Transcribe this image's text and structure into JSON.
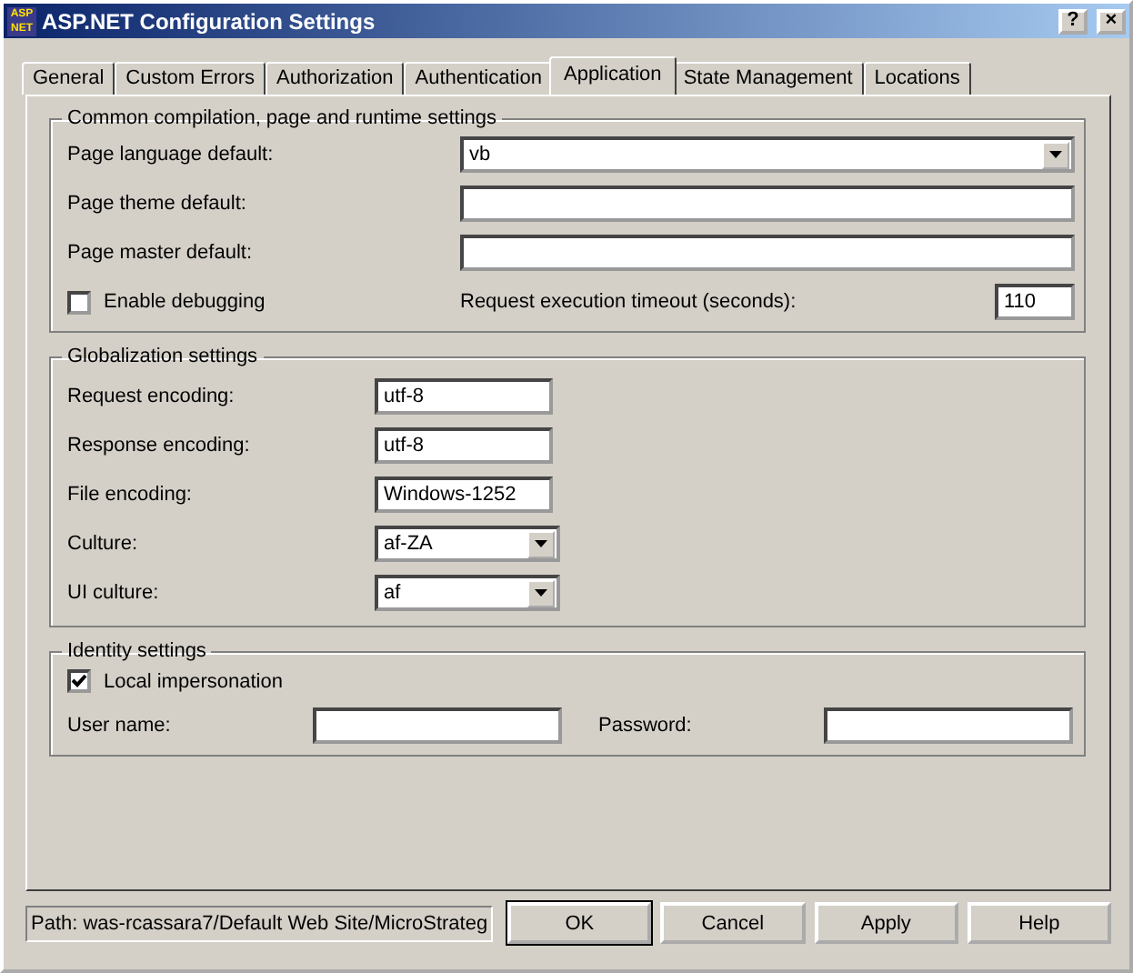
{
  "window": {
    "title": "ASP.NET Configuration Settings",
    "logo": [
      "ASP",
      "NET"
    ],
    "help_button": "?",
    "close_button": "×"
  },
  "tabs": [
    {
      "label": "General",
      "selected": false
    },
    {
      "label": "Custom Errors",
      "selected": false
    },
    {
      "label": "Authorization",
      "selected": false
    },
    {
      "label": "Authentication",
      "selected": false
    },
    {
      "label": "Application",
      "selected": true
    },
    {
      "label": "State Management",
      "selected": false
    },
    {
      "label": "Locations",
      "selected": false
    }
  ],
  "common": {
    "title": "Common compilation, page and runtime settings",
    "fields": [
      {
        "kind": "dropdown",
        "label": "Page language default:",
        "value": "vb"
      },
      {
        "kind": "text",
        "label": "Page theme default:"
      },
      {
        "kind": "text",
        "label": "Page master default:"
      }
    ],
    "debugging": {
      "label": "Enable debugging",
      "checked": false
    },
    "timeout": {
      "label": "Request execution timeout (seconds):",
      "value": "110"
    }
  },
  "globalization": {
    "title": "Globalization settings",
    "fields": [
      {
        "kind": "text",
        "label": "Request encoding:",
        "value": "utf-8"
      },
      {
        "kind": "text",
        "label": "Response encoding:",
        "value": "utf-8"
      },
      {
        "kind": "text",
        "label": "File encoding:",
        "value": "Windows-1252"
      },
      {
        "kind": "dropdown",
        "label": "Culture:",
        "value": "af-ZA"
      },
      {
        "kind": "dropdown",
        "label": "UI culture:",
        "value": "af"
      }
    ]
  },
  "identity": {
    "title": "Identity settings",
    "impersonation": {
      "label": "Local impersonation",
      "checked": true
    },
    "user_name": {
      "label": "User name:"
    },
    "password": {
      "label": "Password:"
    }
  },
  "status_path": "Path: was-rcassara7/Default Web Site/MicroStrateg",
  "buttons": [
    {
      "label": "OK",
      "default": true
    },
    {
      "label": "Cancel",
      "default": false
    },
    {
      "label": "Apply",
      "default": false
    },
    {
      "label": "Help",
      "default": false
    }
  ]
}
